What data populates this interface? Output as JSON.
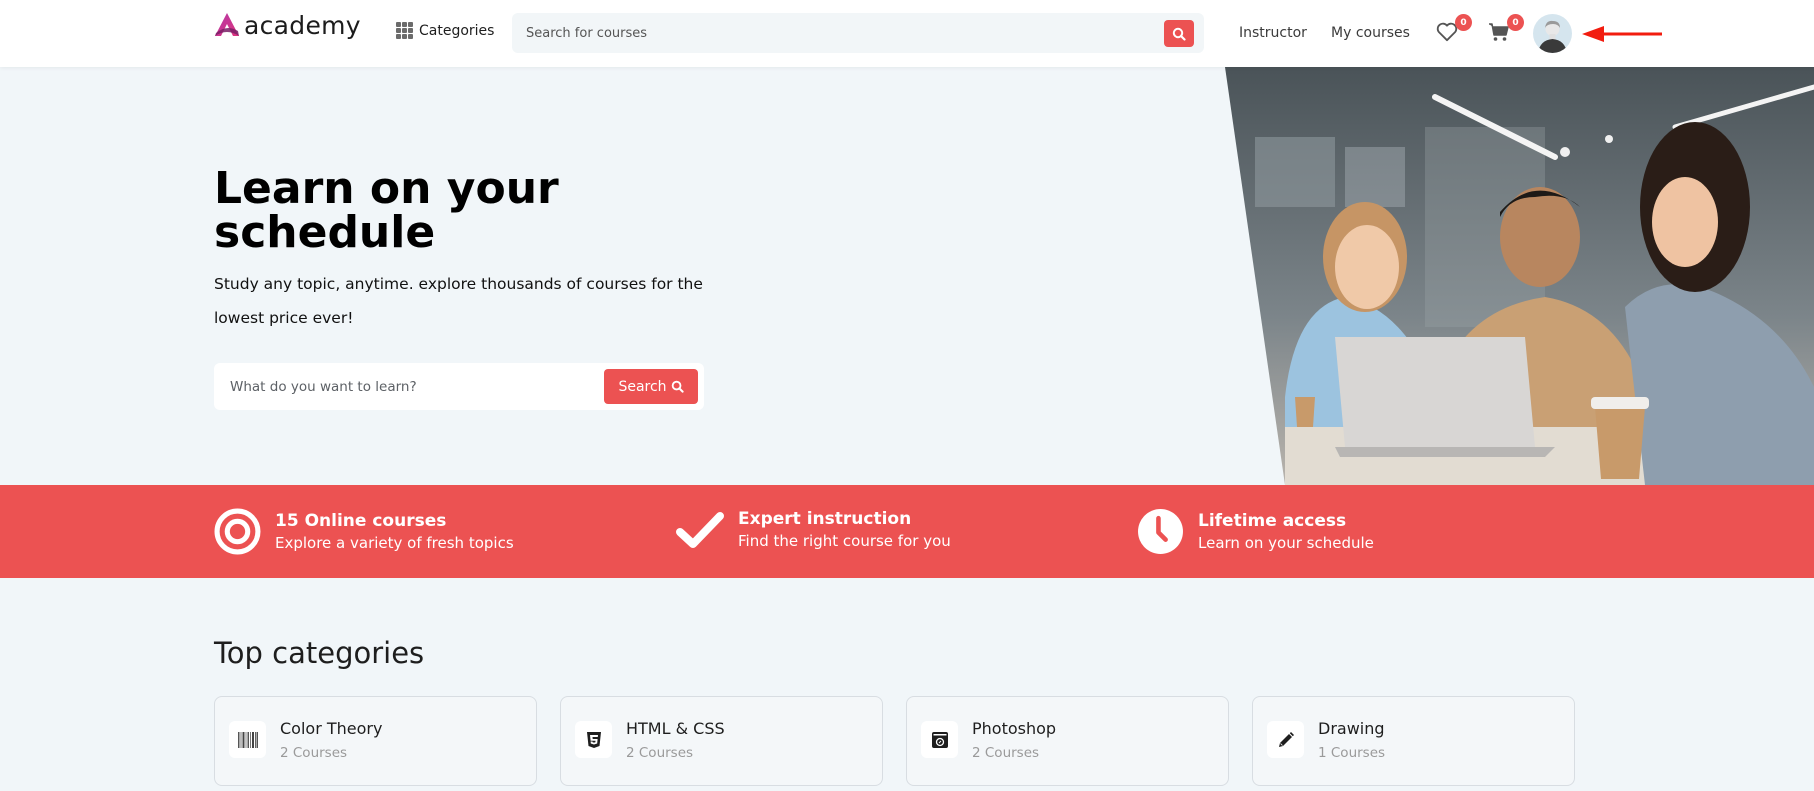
{
  "header": {
    "logo_text": "academy",
    "categories_label": "Categories",
    "search_placeholder": "Search for courses",
    "nav": {
      "instructor": "Instructor",
      "my_courses": "My courses"
    },
    "wishlist_count": "0",
    "cart_count": "0"
  },
  "hero": {
    "title": "Learn on your schedule",
    "subtitle": "Study any topic, anytime. explore thousands of courses for the lowest price ever!",
    "search_placeholder": "What do you want to learn?",
    "search_button": "Search"
  },
  "features": [
    {
      "icon": "target-icon",
      "title": "15 Online courses",
      "desc": "Explore a variety of fresh topics"
    },
    {
      "icon": "check-icon",
      "title": "Expert instruction",
      "desc": "Find the right course for you"
    },
    {
      "icon": "clock-icon",
      "title": "Lifetime access",
      "desc": "Learn on your schedule"
    }
  ],
  "top_categories": {
    "heading": "Top categories",
    "items": [
      {
        "icon": "barcode-icon",
        "name": "Color Theory",
        "count": "2 Courses"
      },
      {
        "icon": "css3-icon",
        "name": "HTML & CSS",
        "count": "2 Courses"
      },
      {
        "icon": "camera-icon",
        "name": "Photoshop",
        "count": "2 Courses"
      },
      {
        "icon": "pencil-icon",
        "name": "Drawing",
        "count": "1 Courses"
      }
    ]
  },
  "colors": {
    "accent": "#ec5252",
    "background": "#f1f6f9",
    "logo_gradient": [
      "#8e2de2",
      "#e0337c"
    ]
  }
}
